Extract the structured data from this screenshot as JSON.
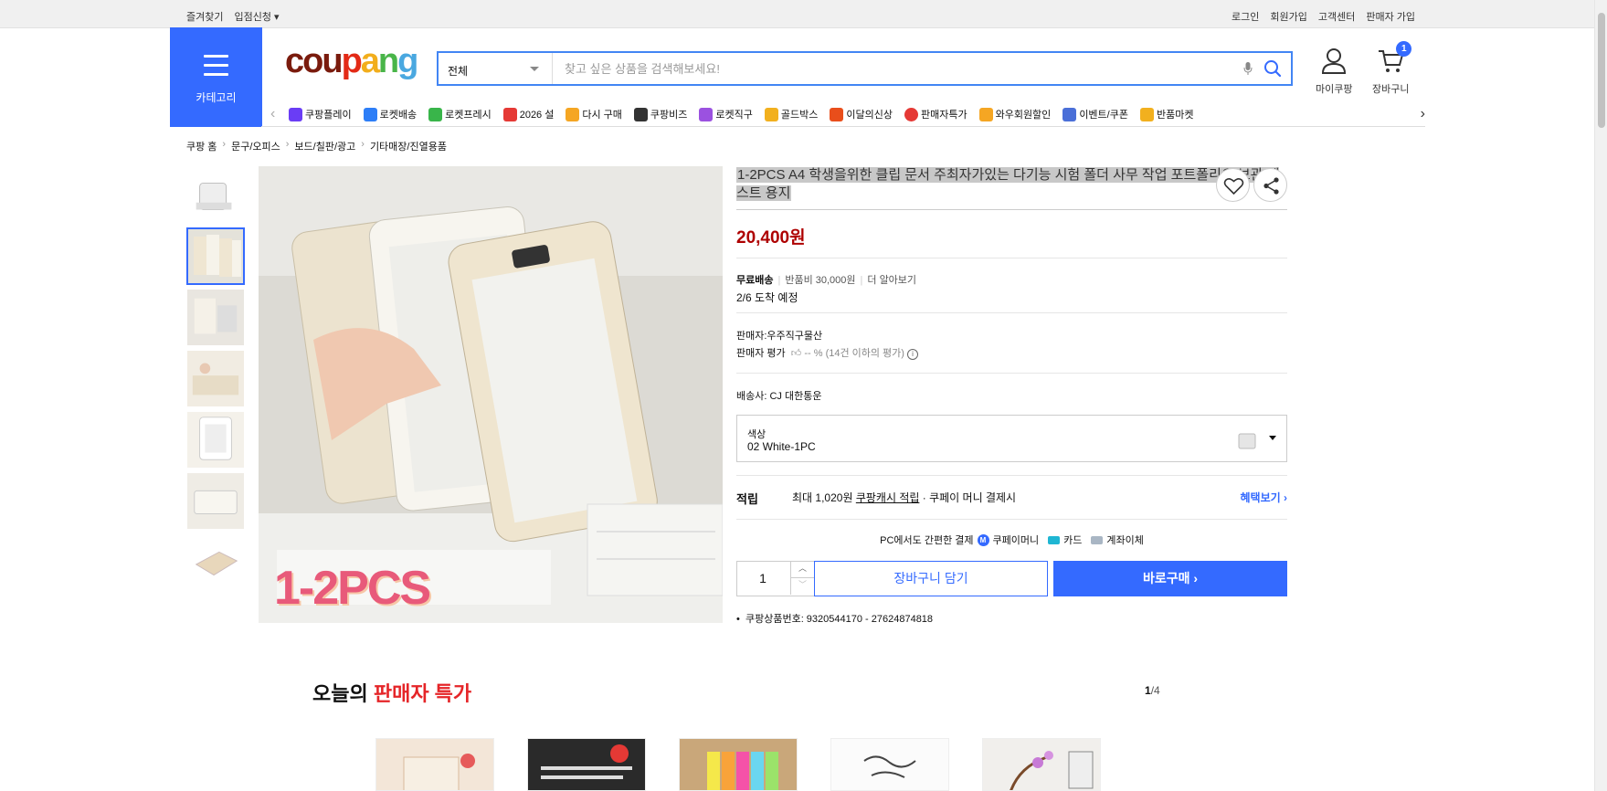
{
  "topbar": {
    "left": [
      "즐겨찾기",
      "입점신청"
    ],
    "right": [
      "로그인",
      "회원가입",
      "고객센터",
      "판매자 가입"
    ]
  },
  "header": {
    "category_label": "카테고리",
    "logo": [
      "cou",
      "p",
      "a",
      "n",
      "g"
    ],
    "search": {
      "category": "전체",
      "placeholder": "찾고 싶은 상품을 검색해보세요!"
    },
    "my_coupang": "마이쿠팡",
    "cart": "장바구니",
    "cart_count": "1"
  },
  "nav": [
    {
      "label": "쿠팡플레이",
      "color": "#6a3df5"
    },
    {
      "label": "로켓배송",
      "color": "#2d7ef7"
    },
    {
      "label": "로켓프레시",
      "color": "#39b54a"
    },
    {
      "label": "2026 설",
      "color": "#e53935"
    },
    {
      "label": "다시 구매",
      "color": "#f5a623"
    },
    {
      "label": "쿠팡비즈",
      "color": "#333333"
    },
    {
      "label": "로켓직구",
      "color": "#9b51e0"
    },
    {
      "label": "골드박스",
      "color": "#f2b01e"
    },
    {
      "label": "이달의신상",
      "color": "#e94e1b"
    },
    {
      "label": "판매자특가",
      "color": "#e53935"
    },
    {
      "label": "와우회원할인",
      "color": "#f5a623"
    },
    {
      "label": "이벤트/쿠폰",
      "color": "#4a6fd8"
    },
    {
      "label": "반품마켓",
      "color": "#f2b01e"
    }
  ],
  "breadcrumb": [
    "쿠팡 홈",
    "문구/오피스",
    "보드/칠판/광고",
    "기타매장/진열용품"
  ],
  "product": {
    "title": "1-2PCS A4 학생을위한 클립 문서 주최자가있는 다기능 시험 폴더 사무 작업 포트폴리오 보관 테스트 용지",
    "price": "20,400원",
    "image_overlay": "1-2PCS",
    "shipping": {
      "free": "무료배송",
      "return_fee": "반품비 30,000원",
      "more": "더 알아보기",
      "arrival": "2/6 도착 예정"
    },
    "seller": "판매자:우주직구물산",
    "seller_rating_label": "판매자 평가",
    "seller_rating_value": "-- % (14건 이하의 평가)",
    "courier": "배송사:  CJ 대한통운",
    "option_key": "색상",
    "option_value": "02 White-1PC",
    "reward_label": "적립",
    "reward_text_1": "최대 1,020원 ",
    "reward_link": "쿠팡캐시 적립",
    "reward_text_2": " · 쿠페이 머니 결제시",
    "reward_more": "혜택보기",
    "pay_title": "PC에서도 간편한 결제",
    "pay_options": [
      "쿠페이머니",
      "카드",
      "계좌이체"
    ],
    "qty": "1",
    "cart_button": "장바구니 담기",
    "buy_button": "바로구매",
    "product_id": "쿠팡상품번호: 9320544170 - 27624874818"
  },
  "section": {
    "title_1": "오늘의 ",
    "title_2": "판매자 특가",
    "page_current": "1",
    "page_total": "/4"
  }
}
